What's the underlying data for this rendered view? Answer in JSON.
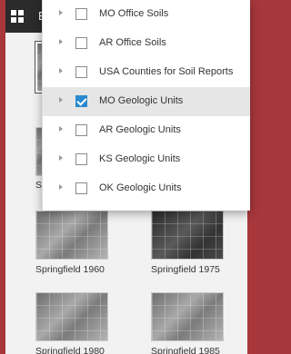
{
  "header": {
    "title": "Ba",
    "grid_icon": "grid-icon"
  },
  "dropdown": {
    "items": [
      {
        "label": "MO Office Soils",
        "checked": false
      },
      {
        "label": "AR Office Soils",
        "checked": false
      },
      {
        "label": "USA Counties for Soil Reports",
        "checked": false
      },
      {
        "label": "MO Geologic Units",
        "checked": true
      },
      {
        "label": "AR Geologic Units",
        "checked": false
      },
      {
        "label": "KS Geologic Units",
        "checked": false
      },
      {
        "label": "OK Geologic Units",
        "checked": false
      }
    ]
  },
  "gallery": {
    "partial_label": "Sp",
    "items": [
      {
        "label": "Springfield 1960"
      },
      {
        "label": "Springfield 1975"
      },
      {
        "label": "Springfield 1980"
      },
      {
        "label": "Springfield 1985"
      }
    ]
  },
  "colors": {
    "frame": "#a8373b",
    "topbar": "#2b2b2b",
    "checkbox_checked": "#2a8ad0"
  }
}
